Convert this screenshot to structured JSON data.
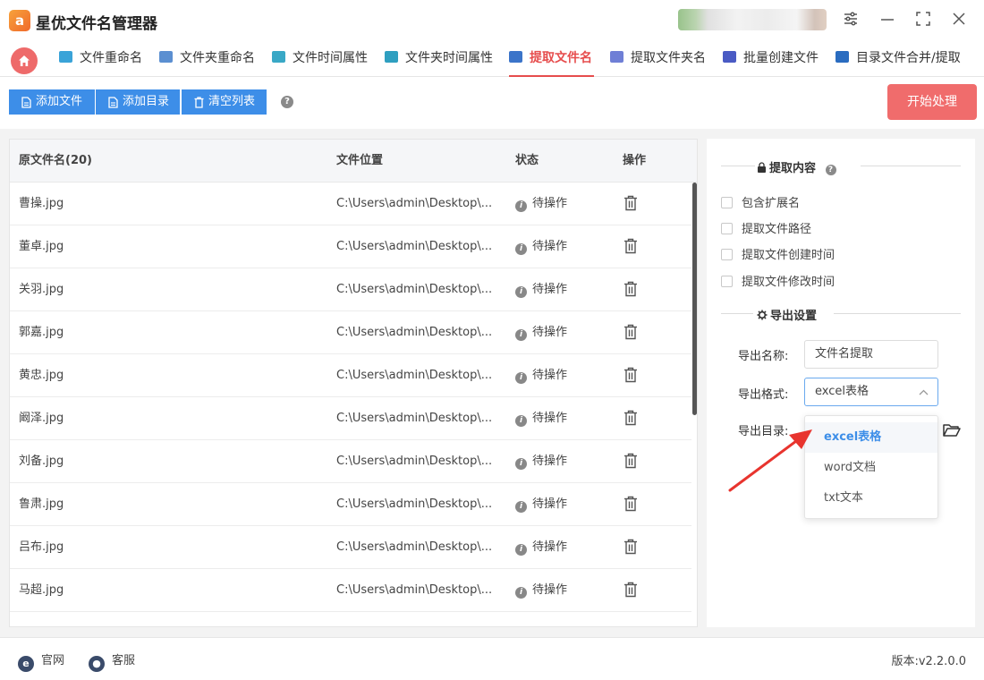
{
  "app": {
    "logo_glyph": "a",
    "title": "星优文件名管理器"
  },
  "window_controls": {
    "settings": "⚙",
    "minimize": "—",
    "maximize": "⛶",
    "close": "✕"
  },
  "tabs": [
    {
      "label": "文件重命名",
      "icon": "rename-file-icon",
      "color": "#3aa3d8"
    },
    {
      "label": "文件夹重命名",
      "icon": "rename-folder-icon",
      "color": "#5b8fd1"
    },
    {
      "label": "文件时间属性",
      "icon": "file-time-icon",
      "color": "#39a8c6"
    },
    {
      "label": "文件夹时间属性",
      "icon": "folder-time-icon",
      "color": "#2f9fc0"
    },
    {
      "label": "提取文件名",
      "icon": "extract-filename-icon",
      "color": "#3b74c9",
      "active": true
    },
    {
      "label": "提取文件夹名",
      "icon": "extract-foldername-icon",
      "color": "#6f7fd6"
    },
    {
      "label": "批量创建文件",
      "icon": "batch-create-icon",
      "color": "#4a5bc4"
    },
    {
      "label": "目录文件合并/提取",
      "icon": "merge-icon",
      "color": "#2a6cc0"
    }
  ],
  "toolbar": {
    "add_file": "添加文件",
    "add_dir": "添加目录",
    "clear_list": "清空列表",
    "help": "?",
    "start": "开始处理"
  },
  "table": {
    "headers": {
      "name": "原文件名(20)",
      "location": "文件位置",
      "status": "状态",
      "action": "操作"
    },
    "rows": [
      {
        "name": "曹操.jpg",
        "location": "C:\\Users\\admin\\Desktop\\...",
        "status": "待操作"
      },
      {
        "name": "董卓.jpg",
        "location": "C:\\Users\\admin\\Desktop\\...",
        "status": "待操作"
      },
      {
        "name": "关羽.jpg",
        "location": "C:\\Users\\admin\\Desktop\\...",
        "status": "待操作"
      },
      {
        "name": "郭嘉.jpg",
        "location": "C:\\Users\\admin\\Desktop\\...",
        "status": "待操作"
      },
      {
        "name": "黄忠.jpg",
        "location": "C:\\Users\\admin\\Desktop\\...",
        "status": "待操作"
      },
      {
        "name": "阚泽.jpg",
        "location": "C:\\Users\\admin\\Desktop\\...",
        "status": "待操作"
      },
      {
        "name": "刘备.jpg",
        "location": "C:\\Users\\admin\\Desktop\\...",
        "status": "待操作"
      },
      {
        "name": "鲁肃.jpg",
        "location": "C:\\Users\\admin\\Desktop\\...",
        "status": "待操作"
      },
      {
        "name": "吕布.jpg",
        "location": "C:\\Users\\admin\\Desktop\\...",
        "status": "待操作"
      },
      {
        "name": "马超.jpg",
        "location": "C:\\Users\\admin\\Desktop\\...",
        "status": "待操作"
      }
    ]
  },
  "settings": {
    "extract_section": "提取内容",
    "options": [
      {
        "label": "包含扩展名",
        "checked": false
      },
      {
        "label": "提取文件路径",
        "checked": false
      },
      {
        "label": "提取文件创建时间",
        "checked": false
      },
      {
        "label": "提取文件修改时间",
        "checked": false
      }
    ],
    "export_section": "导出设置",
    "export_name_label": "导出名称:",
    "export_name_value": "文件名提取",
    "export_format_label": "导出格式:",
    "export_format_value": "excel表格",
    "export_dir_label": "导出目录:",
    "format_options": [
      "excel表格",
      "word文档",
      "txt文本"
    ]
  },
  "footer": {
    "website": "官网",
    "support": "客服",
    "version": "版本:v2.2.0.0"
  },
  "colors": {
    "accent_red": "#e64d4d",
    "accent_blue": "#3d8ee8",
    "arrow": "#e8342e"
  }
}
